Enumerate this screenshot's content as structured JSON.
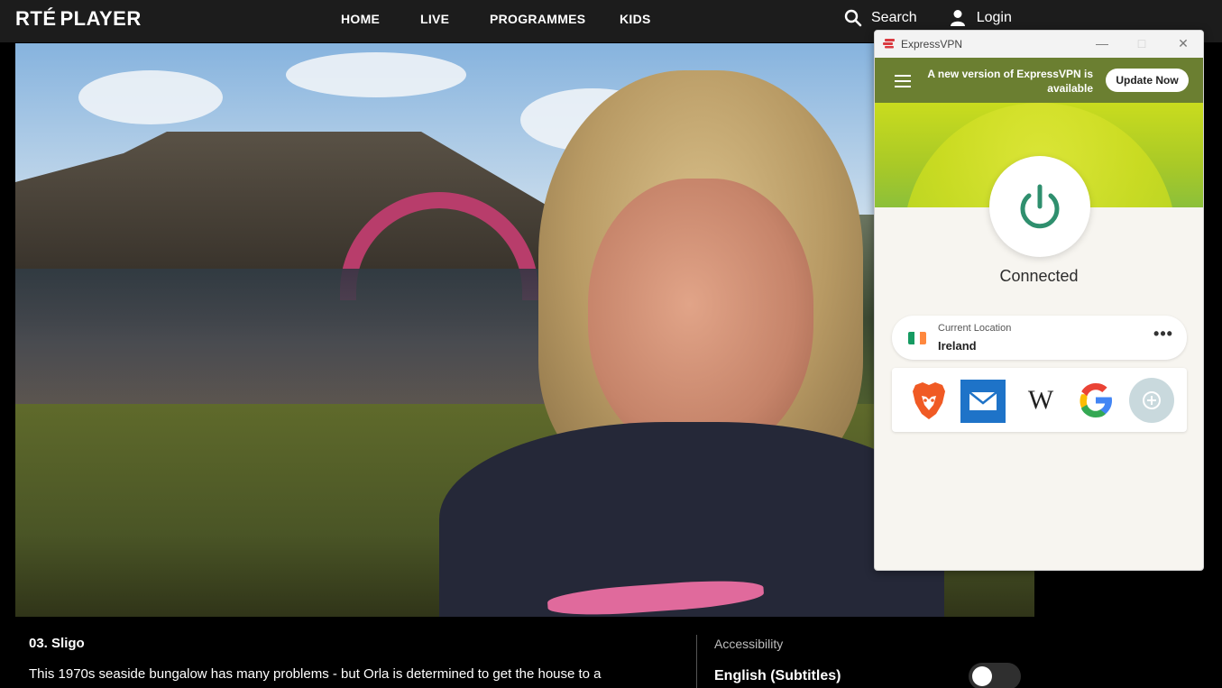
{
  "nav": {
    "logo_prefix": "RTÉ",
    "logo_suffix": "PLAYER",
    "links": [
      "HOME",
      "LIVE",
      "PROGRAMMES",
      "KIDS"
    ],
    "search_label": "Search",
    "login_label": "Login"
  },
  "player": {
    "episode_title": "03. Sligo",
    "description": "This 1970s seaside bungalow has many problems - but Orla is determined to get the house to a",
    "accessibility_label": "Accessibility",
    "subtitles_label": "English (Subtitles)",
    "subtitles_enabled": false
  },
  "vpn": {
    "window_title": "ExpressVPN",
    "banner_text": "A new version of ExpressVPN is available",
    "update_button": "Update Now",
    "status": "Connected",
    "location_label": "Current Location",
    "location_value": "Ireland",
    "more_label": "•••",
    "shortcuts": [
      "brave-icon",
      "mail-icon",
      "wikipedia-icon",
      "google-icon",
      "add-shortcut-icon"
    ],
    "wiki_glyph": "W",
    "colors": {
      "accent_green": "#2f8f6e",
      "banner": "#6b7f31",
      "hero_yellow": "#c9dc1e"
    }
  }
}
